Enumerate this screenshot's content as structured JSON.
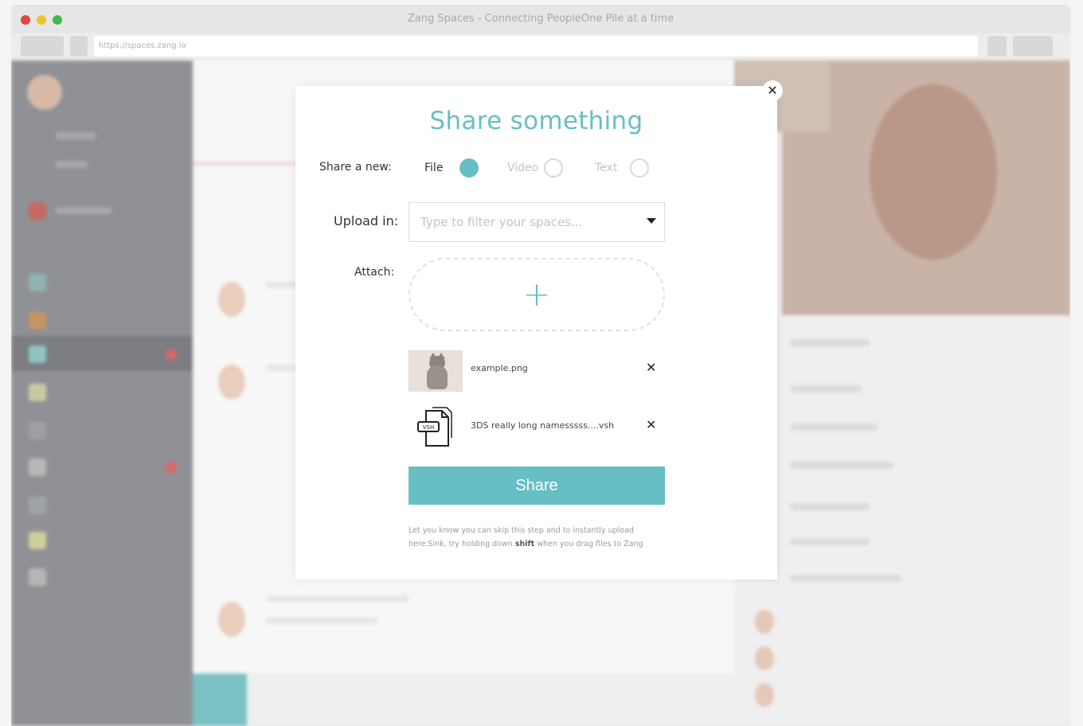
{
  "window": {
    "title": "Zang Spaces - Connecting PeopleOne Pile at a time",
    "url": "https://spaces.zang.io"
  },
  "modal": {
    "title": "Share something",
    "share_label": "Share a new:",
    "options": {
      "file": "File",
      "video": "Video",
      "text": "Text"
    },
    "selected": "File",
    "upload_label": "Upload in:",
    "select_placeholder": "Type to filter your spaces...",
    "attach_label": "Attach:",
    "files": [
      {
        "name": "example.png",
        "thumb": "cat-image"
      },
      {
        "name": "3DS really long namesssss....vsh",
        "thumb": "document-icon"
      }
    ],
    "share_button": "Share",
    "hint_pre": "Let you know you can skip this step and to instantly upload here.Sink, try holding down",
    "hint_key": "shift",
    "hint_post": "when you drag files to Zang"
  },
  "colors": {
    "accent": "#67bfc4",
    "sidebar": "#8f9196"
  }
}
